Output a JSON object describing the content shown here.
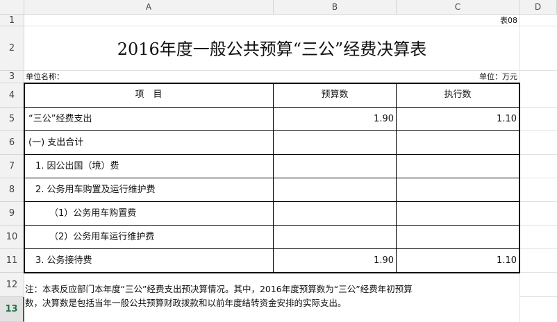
{
  "sheet": {
    "columns": [
      "A",
      "B",
      "C",
      "D"
    ],
    "rows": [
      "1",
      "2",
      "3",
      "4",
      "5",
      "6",
      "7",
      "8",
      "9",
      "10",
      "11",
      "12",
      "13"
    ],
    "selected_row": "13"
  },
  "doc": {
    "table_no": "表08",
    "title": "2016年度一般公共预算“三公”经费决算表",
    "unit_name_label": "单位名称：",
    "unit_label": "单位：万元"
  },
  "table": {
    "headers": [
      "项　目",
      "预算数",
      "执行数"
    ],
    "rows": [
      {
        "item": "“三公”经费支出",
        "budget": "1.90",
        "actual": "1.10"
      },
      {
        "item": "(一) 支出合计",
        "budget": "",
        "actual": ""
      },
      {
        "item": "1. 因公出国（境）费",
        "budget": "",
        "actual": ""
      },
      {
        "item": "2. 公务用车购置及运行维护费",
        "budget": "",
        "actual": ""
      },
      {
        "item": "（1）公务用车购置费",
        "budget": "",
        "actual": ""
      },
      {
        "item": "（2）公务用车运行维护费",
        "budget": "",
        "actual": ""
      },
      {
        "item": "3. 公务接待费",
        "budget": "1.90",
        "actual": "1.10"
      }
    ]
  },
  "note": {
    "line1": "注：本表反应部门本年度“三公”经费支出预决算情况。其中，2016年度预算数为“三公”经费年初预算",
    "line2": "数，决算数是包括当年一般公共预算财政拨款和以前年度结转资金安排的实际支出。"
  }
}
